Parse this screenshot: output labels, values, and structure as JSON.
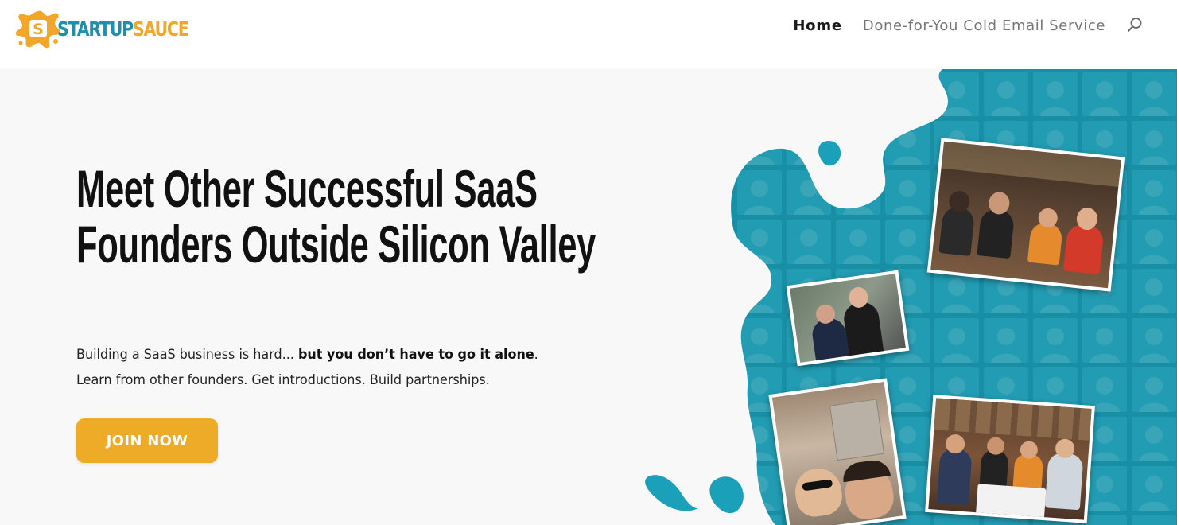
{
  "brand": {
    "logo_word1": "STARTUP",
    "logo_word2": "SAUCE",
    "logo_icon": "splash-dollar-icon",
    "color_blue": "#1f8fae",
    "color_orange": "#f3a72a"
  },
  "nav": {
    "items": [
      {
        "label": "Home",
        "active": true
      },
      {
        "label": "Done-for-You Cold Email Service",
        "active": false
      }
    ],
    "search_icon": "search-icon"
  },
  "hero": {
    "headline_line1": "Meet Other Successful SaaS",
    "headline_line2": "Founders Outside Silicon Valley",
    "sub_line1_start": "Building a SaaS business is hard... ",
    "sub_line1_emphasis": "but you don’t have to go it alone",
    "sub_line1_end": ".",
    "sub_line2": "Learn from other founders. Get introductions. Build partnerships.",
    "cta_label": "JOIN NOW",
    "cta_color": "#eeab27",
    "splash_color": "#1aa0b8"
  }
}
